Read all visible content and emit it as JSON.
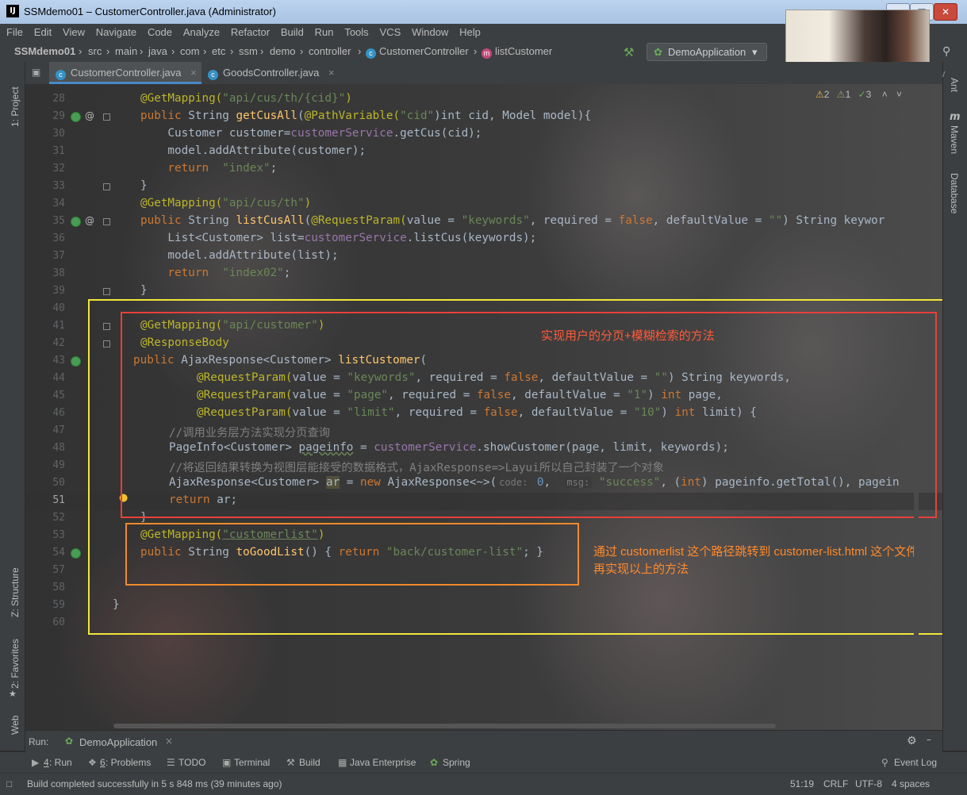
{
  "window": {
    "title": "SSMdemo01 – CustomerController.java (Administrator)",
    "logo": "IJ"
  },
  "menu": [
    "File",
    "Edit",
    "View",
    "Navigate",
    "Code",
    "Analyze",
    "Refactor",
    "Build",
    "Run",
    "Tools",
    "VCS",
    "Window",
    "Help"
  ],
  "breadcrumb": [
    "SSMdemo01",
    "src",
    "main",
    "java",
    "com",
    "etc",
    "ssm",
    "demo",
    "controller",
    "CustomerController",
    "listCustomer"
  ],
  "run_config": "DemoApplication",
  "tabs": [
    {
      "label": "CustomerController.java",
      "active": true
    },
    {
      "label": "GoodsController.java",
      "active": false
    }
  ],
  "left_tools": {
    "project": "1: Project",
    "structure": "Z: Structure",
    "favorites": "2: Favorites",
    "web": "Web"
  },
  "right_tools": {
    "ant": "Ant",
    "maven": "Maven",
    "database": "Database",
    "cut_label": "Mav"
  },
  "inspections": {
    "errors": "2",
    "warnings": "1",
    "ok": "3"
  },
  "lines": [
    "28",
    "29",
    "30",
    "31",
    "32",
    "33",
    "34",
    "35",
    "36",
    "37",
    "38",
    "39",
    "40",
    "41",
    "42",
    "43",
    "44",
    "45",
    "46",
    "47",
    "48",
    "49",
    "50",
    "51",
    "52",
    "53",
    "54",
    "57",
    "58",
    "59",
    "60"
  ],
  "code": {
    "l28": {
      "an": "@GetMapping(",
      "st": "\"api/cus/th/{cid}\"",
      "end": ")"
    },
    "l29": {
      "kw": "public",
      "t1": " String ",
      "fn": "getCusAll",
      "t2": "(",
      "an": "@PathVariable(",
      "st": "\"cid\"",
      "t3": ")int cid, Model model){"
    },
    "l30": {
      "t1": "    Customer customer=",
      "fd": "customerService",
      "t2": ".getCus(cid);"
    },
    "l31": {
      "t1": "    model.addAttribute(customer);"
    },
    "l32": {
      "kw": "    return  ",
      "st": "\"index\"",
      "t1": ";"
    },
    "l33": {
      "t1": "}"
    },
    "l34": {
      "an": "@GetMapping(",
      "st": "\"api/cus/th\"",
      "end": ")"
    },
    "l35": {
      "kw": "public",
      "t1": " String ",
      "fn": "listCusAll",
      "t2": "(",
      "an": "@RequestParam(",
      "t3": "value = ",
      "st": "\"keywords\"",
      "t4": ", required = ",
      "kw2": "false",
      "t5": ", defaultValue = ",
      "st2": "\"\"",
      "t6": ") String keywor"
    },
    "l36": {
      "t1": "    List<Customer> list=",
      "fd": "customerService",
      "t2": ".listCus(keywords);"
    },
    "l37": {
      "t1": "    model.addAttribute(list);"
    },
    "l38": {
      "kw": "    return  ",
      "st": "\"index02\"",
      "t1": ";"
    },
    "l39": {
      "t1": "}"
    },
    "l41": {
      "an": "@GetMapping(",
      "st": "\"api/customer\"",
      "end": ")"
    },
    "l42": {
      "an": "@ResponseBody"
    },
    "l43": {
      "kw": "public",
      "t1": " AjaxResponse<Customer> ",
      "fn": "listCustomer",
      "t2": "("
    },
    "l44": {
      "an": "@RequestParam(",
      "t1": "value = ",
      "st": "\"keywords\"",
      "t2": ", required = ",
      "kw": "false",
      "t3": ", defaultValue = ",
      "st2": "\"\"",
      "t4": ") String keywords,"
    },
    "l45": {
      "an": "@RequestParam(",
      "t1": "value = ",
      "st": "\"page\"",
      "t2": ", required = ",
      "kw": "false",
      "t3": ", defaultValue = ",
      "st2": "\"1\"",
      "t4": ") ",
      "kw2": "int",
      "t5": " page,"
    },
    "l46": {
      "an": "@RequestParam(",
      "t1": "value = ",
      "st": "\"limit\"",
      "t2": ", required = ",
      "kw": "false",
      "t3": ", defaultValue = ",
      "st2": "\"10\"",
      "t4": ") ",
      "kw2": "int",
      "t5": " limit) {"
    },
    "l47": {
      "cm": "//调用业务层方法实现分页查询"
    },
    "l48": {
      "t1": "PageInfo<Customer> ",
      "t2": "pageinfo",
      " t3": "",
      "t3b": " = ",
      "fd": "customerService",
      "t4": ".showCustomer(page, limit, keywords);"
    },
    "l49": {
      "cm": "//将返回结果转换为视图层能接受的数据格式，AjaxResponse=>Layui所以自己封装了一个对象"
    },
    "l50": {
      "t1": "AjaxResponse<Customer> ",
      "t2": "ar",
      " t3": "",
      "t3b": " = ",
      "kw": "new",
      "t4": " AjaxResponse<~>(",
      "h1": "code:",
      "nm": " 0",
      "t5": ",  ",
      "h2": "msg:",
      "st": " \"success\"",
      "t6": ", (",
      "kw2": "int",
      "t7": ") pageinfo.getTotal(), pagein"
    },
    "l51": {
      "kw": "return",
      "t1": " ar;"
    },
    "l52": {
      "t1": "}"
    },
    "l53": {
      "an": "@GetMapping(",
      "st": "\"customerlist\"",
      "end": ")"
    },
    "l54": {
      "kw": "public",
      "t1": " String ",
      "fn": "toGoodList",
      "t2": "() { ",
      "kw2": "return",
      "st": " \"back/customer-list\"",
      "t3": "; }"
    },
    "l59": {
      "t1": "}"
    }
  },
  "annotations": {
    "red_note": "实现用户的分页+模糊检索的方法",
    "orange_note_1": "通过 customerlist 这个路径跳转到 customer-list.html 这个文件",
    "orange_note_2": "再实现以上的方法"
  },
  "colors": {
    "yellow_box": "#f0e63a",
    "red_box": "#e8403a",
    "orange_box": "#f08a2c",
    "note_red": "#ff5a3a",
    "note_orange": "#ff8a2c"
  },
  "run_panel": {
    "label": "Run:",
    "config": "DemoApplication"
  },
  "tool_windows": [
    {
      "num": "4",
      "label": ": Run"
    },
    {
      "num": "6",
      "label": ": Problems"
    },
    {
      "label": "TODO"
    },
    {
      "label": "Terminal"
    },
    {
      "label": "Build"
    },
    {
      "label": "Java Enterprise"
    },
    {
      "label": "Spring"
    },
    {
      "label": "Event Log"
    }
  ],
  "status": {
    "message": "Build completed successfully in 5 s 848 ms (39 minutes ago)",
    "position": "51:19",
    "line_sep": "CRLF",
    "encoding": "UTF-8",
    "indent": "4 spaces"
  }
}
